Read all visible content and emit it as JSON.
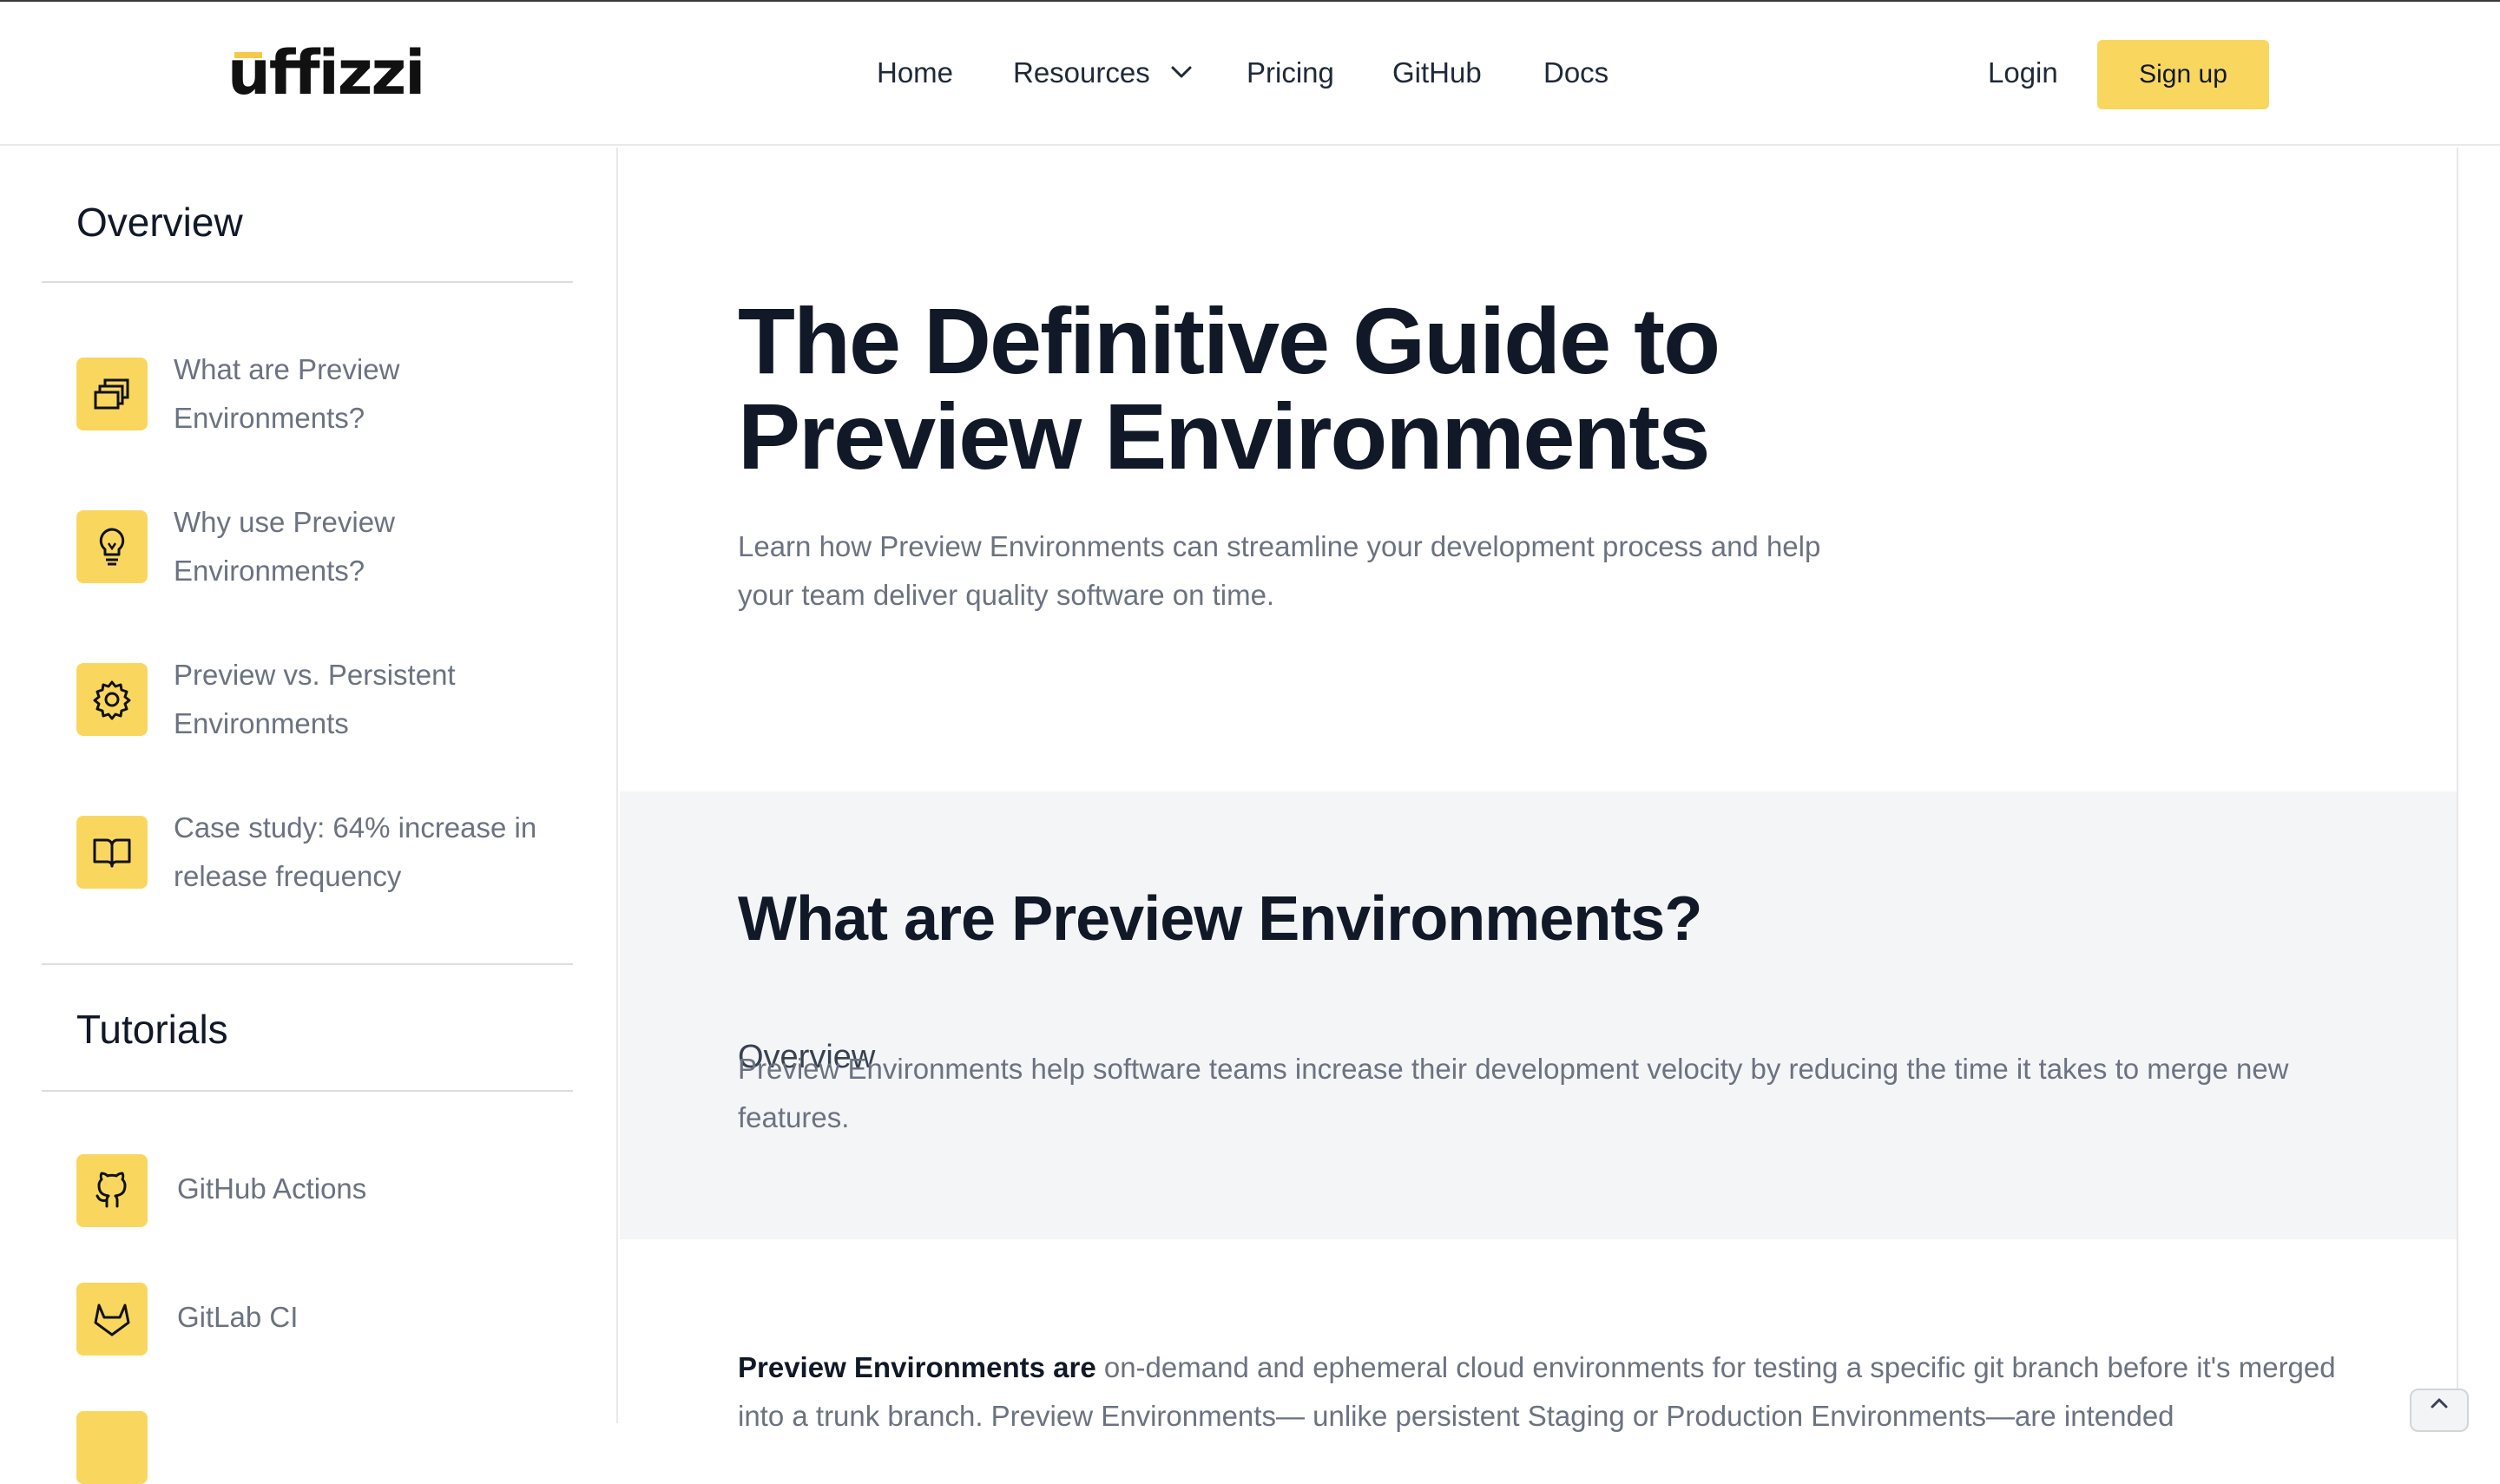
{
  "brand": {
    "logo_text": "uffizzi"
  },
  "nav": {
    "items": [
      "Home",
      "Resources",
      "Pricing",
      "GitHub",
      "Docs"
    ],
    "login": "Login",
    "signup": "Sign up"
  },
  "sidebar": {
    "overview_title": "Overview",
    "overview_items": [
      {
        "label": "What are Preview Environments?",
        "icon": "windows-icon"
      },
      {
        "label": "Why use Preview Environments?",
        "icon": "lightbulb-icon"
      },
      {
        "label": "Preview vs. Persistent Environments",
        "icon": "gear-icon"
      },
      {
        "label": "Case study: 64% increase in release frequency",
        "icon": "book-icon"
      }
    ],
    "tutorials_title": "Tutorials",
    "tutorial_items": [
      {
        "label": "GitHub Actions",
        "icon": "github-icon"
      },
      {
        "label": "GitLab CI",
        "icon": "gitlab-icon"
      }
    ]
  },
  "hero": {
    "title": "The Definitive Guide to Preview Environments",
    "subtitle": "Learn how Preview Environments can streamline your development process and help your team deliver quality software on time."
  },
  "section": {
    "kicker": "Overview",
    "title": "What are Preview Environments?",
    "subtitle": "Preview Environments help software teams increase their development velocity by reducing the time it takes to merge new features."
  },
  "body": {
    "lead_bold": "Preview Environments are",
    "lead_rest": " on-demand and ephemeral cloud environments for testing a specific git branch before it's merged into a trunk branch. Preview Environments— unlike persistent Staging or Production Environments—are intended"
  },
  "colors": {
    "accent": "#f9d75f",
    "text": "#111827",
    "muted": "#6b7280",
    "band": "#f4f5f7"
  }
}
